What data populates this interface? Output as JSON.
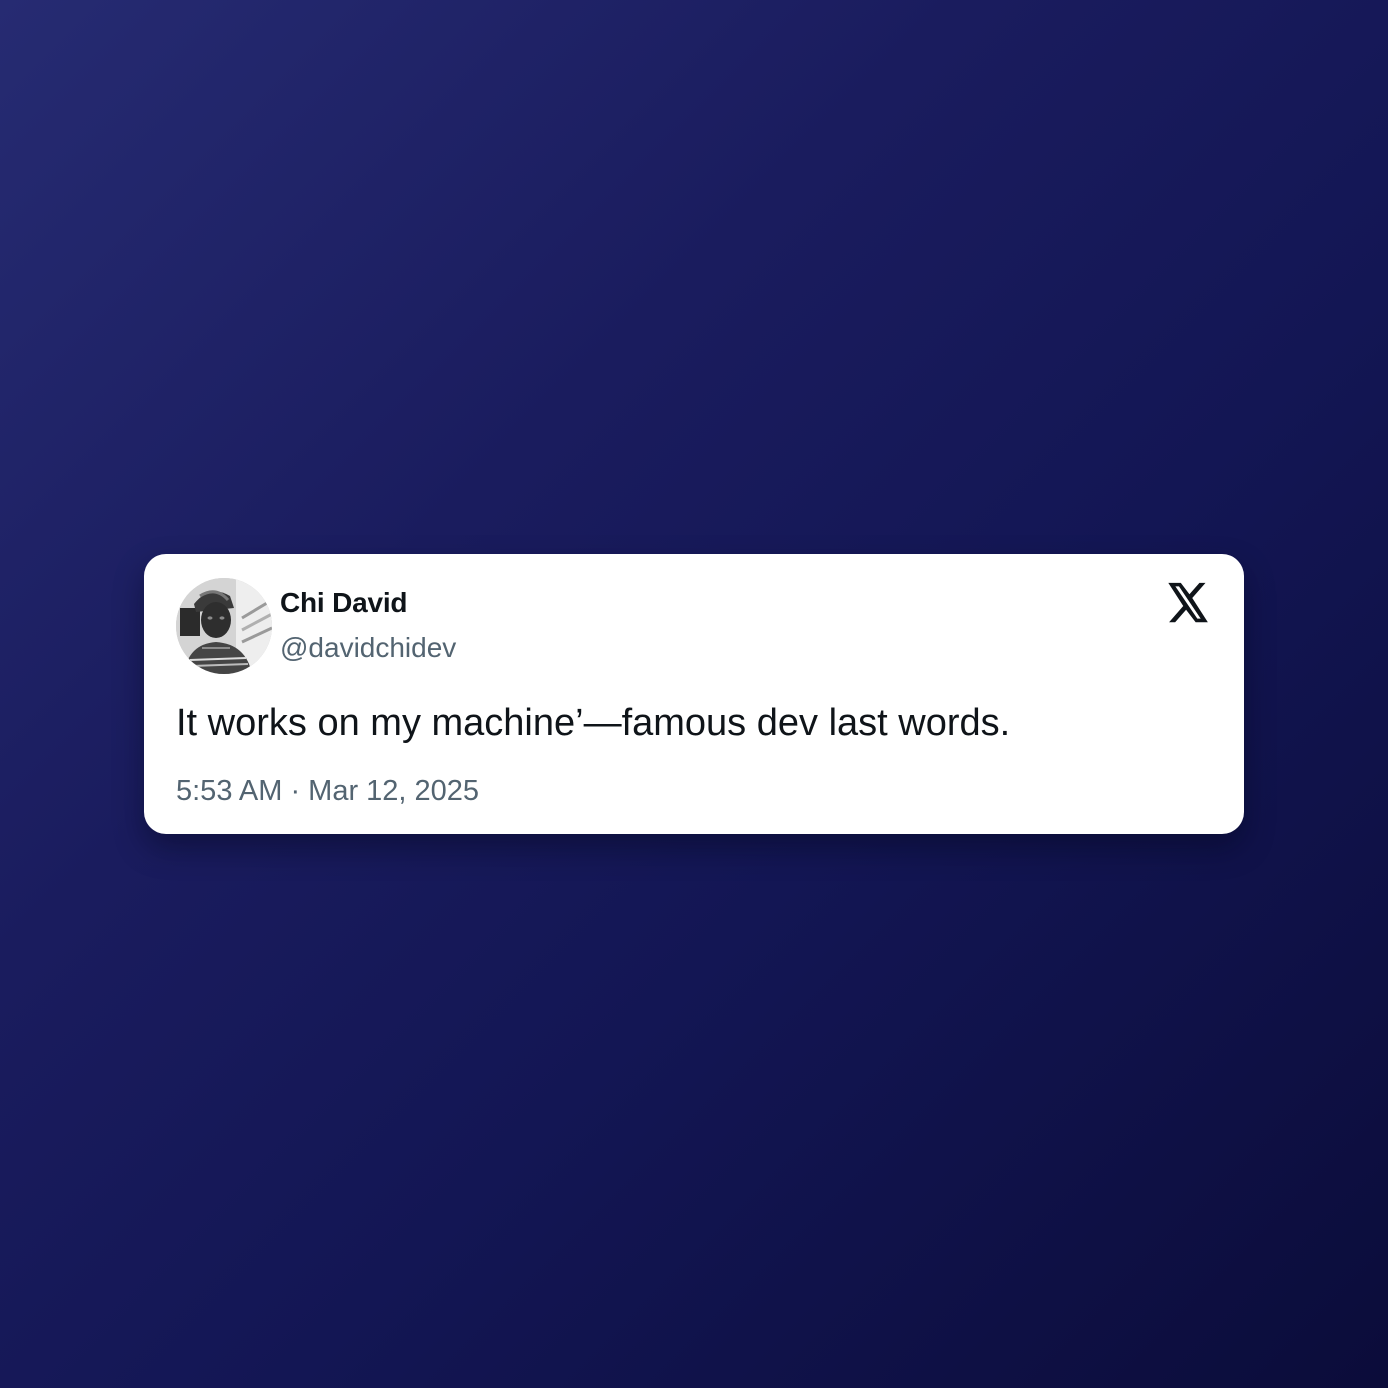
{
  "tweet": {
    "display_name": "Chi David",
    "handle": "@davidchidev",
    "text": "It works on my machine’—famous dev last words.",
    "timestamp": "5:53 AM · Mar 12, 2025"
  },
  "icons": {
    "brand": "x-logo-icon",
    "avatar": "avatar"
  },
  "colors": {
    "background_start": "#262b72",
    "background_end": "#0b0c3a",
    "card": "#ffffff",
    "text_primary": "#0f1419",
    "text_secondary": "#536471"
  }
}
